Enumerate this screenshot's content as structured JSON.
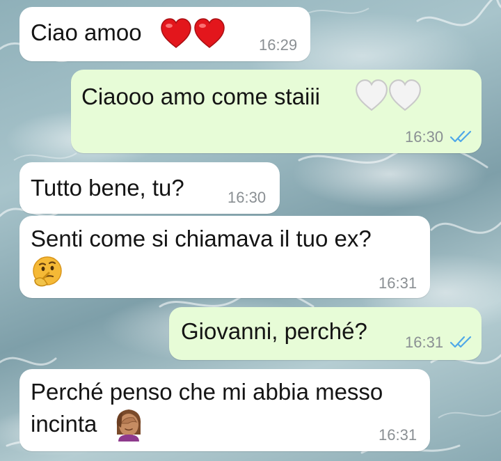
{
  "messages": [
    {
      "direction": "incoming",
      "text": "Ciao amoo",
      "emoji": [
        "red-heart",
        "red-heart"
      ],
      "time": "16:29"
    },
    {
      "direction": "outgoing",
      "text": "Ciaooo amo come staiii",
      "emoji": [
        "white-heart",
        "white-heart"
      ],
      "time": "16:30",
      "status": "read"
    },
    {
      "direction": "incoming",
      "text": "Tutto bene, tu?",
      "emoji": [],
      "time": "16:30"
    },
    {
      "direction": "incoming",
      "text": "Senti come si chiamava il tuo ex?",
      "emoji": [
        "thinking-face"
      ],
      "time": "16:31"
    },
    {
      "direction": "outgoing",
      "text": "Giovanni, perché?",
      "emoji": [],
      "time": "16:31",
      "status": "read"
    },
    {
      "direction": "incoming",
      "text_line1": "Perché penso che mi abbia messo",
      "text_line2": "incinta",
      "emoji": [
        "woman-facepalming"
      ],
      "time": "16:31"
    }
  ],
  "colors": {
    "incoming_bubble": "#ffffff",
    "outgoing_bubble": "#e7fcd7",
    "read_ticks": "#4fa8e8",
    "timestamp": "#8a8f93"
  }
}
